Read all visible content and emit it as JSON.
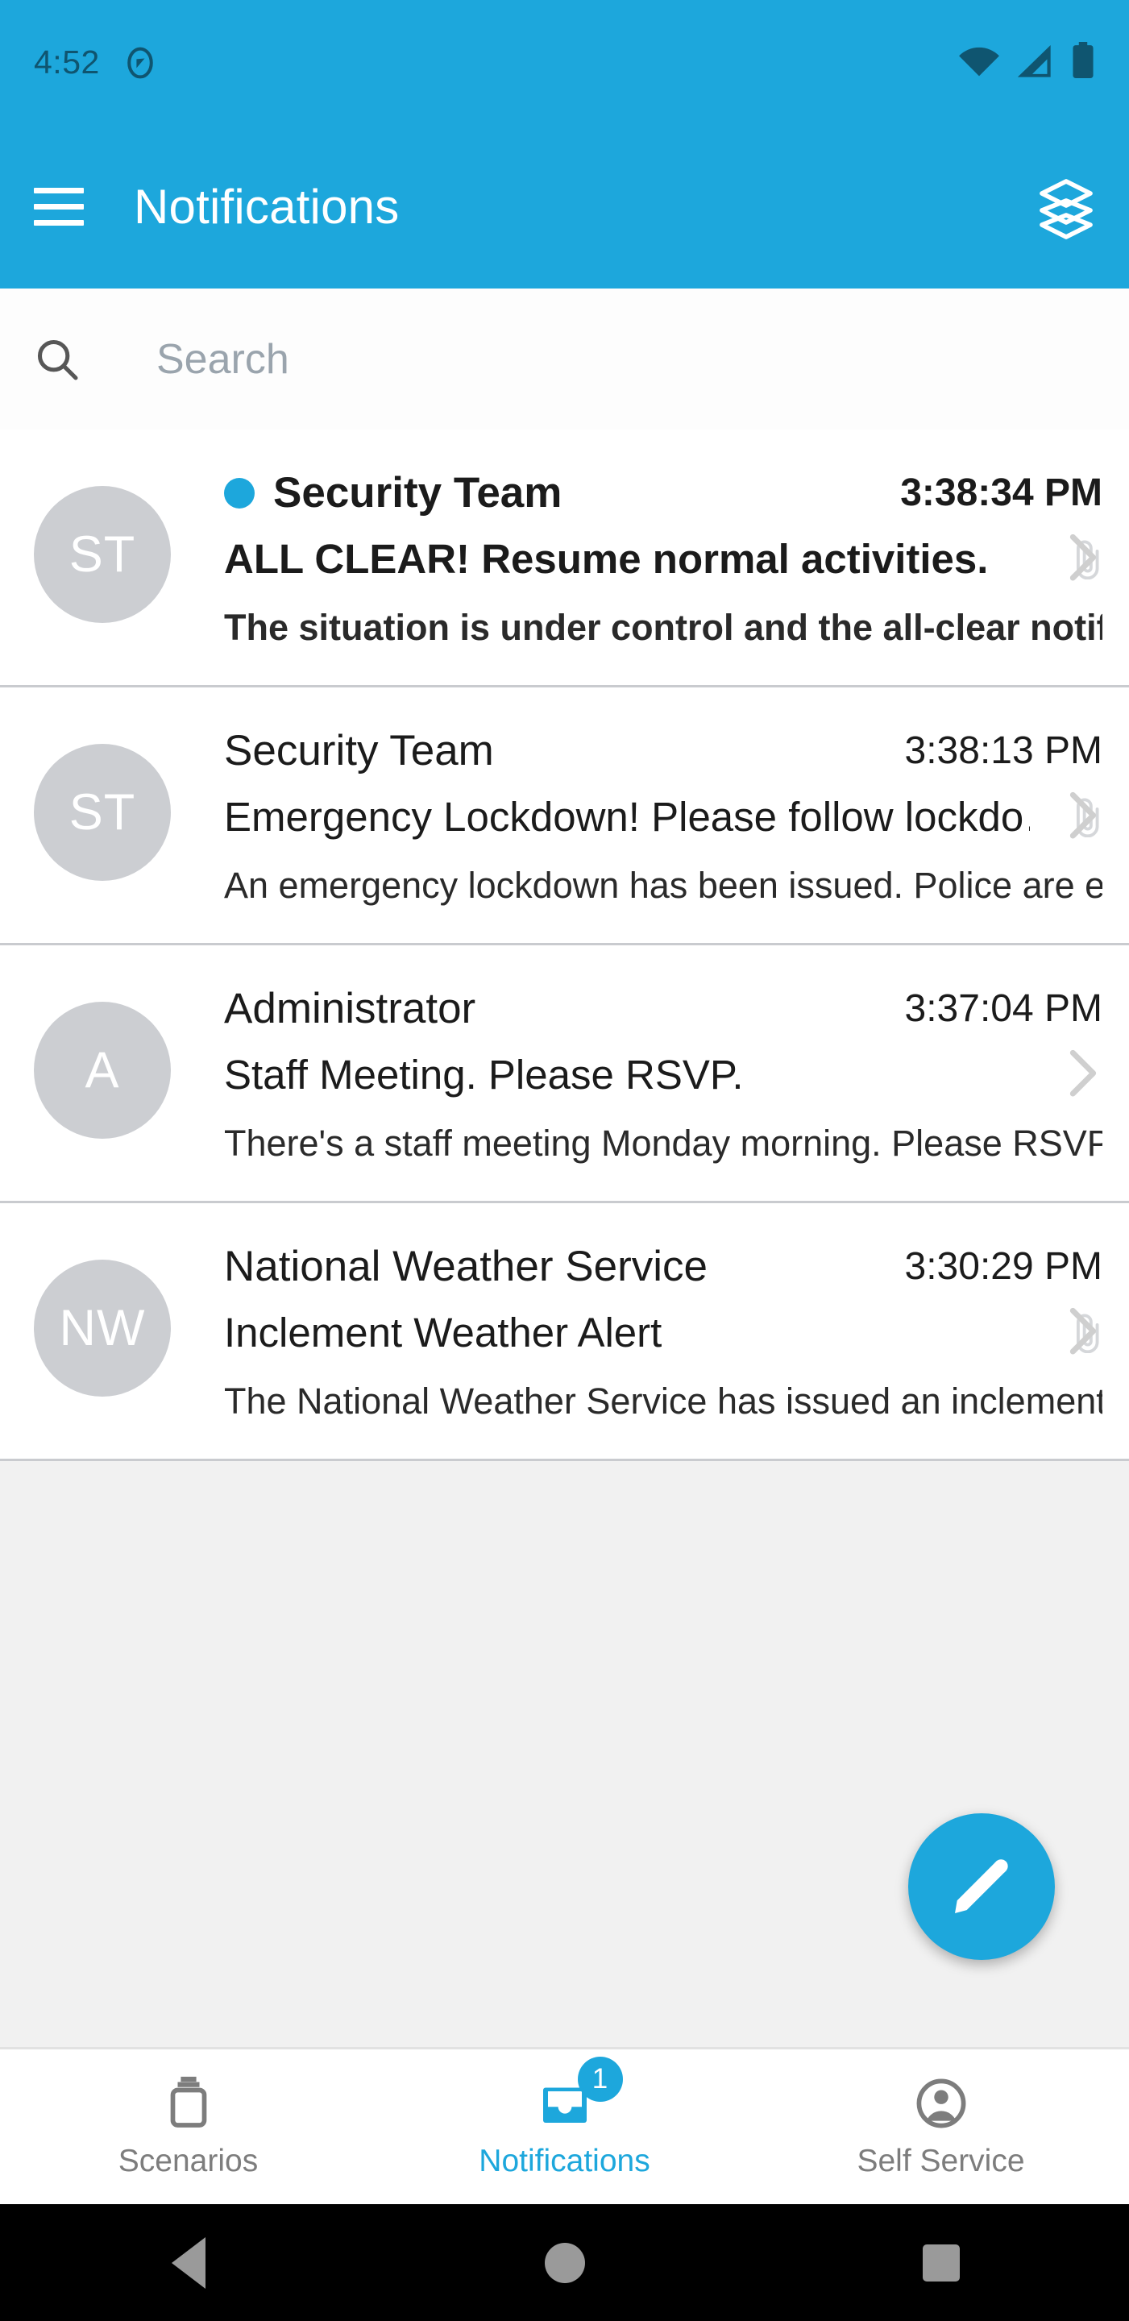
{
  "statusbar": {
    "time": "4:52",
    "icons": [
      "do-not-disturb-icon",
      "wifi-icon",
      "cellular-signal-icon",
      "battery-icon"
    ]
  },
  "appbar": {
    "menu_icon": "hamburger-menu-icon",
    "title": "Notifications",
    "action_icon": "layers-stack-icon"
  },
  "search": {
    "icon": "search-icon",
    "placeholder": "Search",
    "value": ""
  },
  "notifications": [
    {
      "avatar_initials": "ST",
      "sender": "Security Team",
      "time": "3:38:34 PM",
      "subject": "ALL CLEAR! Resume normal activities.",
      "preview": "The situation is under control and the all-clear notificat…",
      "unread": true,
      "has_attachment": true
    },
    {
      "avatar_initials": "ST",
      "sender": "Security Team",
      "time": "3:38:13 PM",
      "subject": "Emergency Lockdown! Please follow lockdo…",
      "preview": "An emergency lockdown has been issued. Police are en-…",
      "unread": false,
      "has_attachment": true
    },
    {
      "avatar_initials": "A",
      "sender": "Administrator",
      "time": "3:37:04 PM",
      "subject": "Staff Meeting. Please RSVP.",
      "preview": "There's a staff meeting Monday morning. Please RSVP a…",
      "unread": false,
      "has_attachment": false
    },
    {
      "avatar_initials": "NW",
      "sender": "National Weather Service",
      "time": "3:30:29 PM",
      "subject": "Inclement Weather Alert",
      "preview": "The National Weather Service has issued an inclement w…",
      "unread": false,
      "has_attachment": true
    }
  ],
  "fab": {
    "icon": "compose-pencil-icon",
    "label": "Compose"
  },
  "bottomnav": {
    "items": [
      {
        "label": "Scenarios",
        "icon": "scenarios-icon",
        "active": false,
        "badge": ""
      },
      {
        "label": "Notifications",
        "icon": "inbox-icon",
        "active": true,
        "badge": "1"
      },
      {
        "label": "Self Service",
        "icon": "account-circle-icon",
        "active": false,
        "badge": ""
      }
    ]
  },
  "androidnav": {
    "back": "back-triangle-icon",
    "home": "home-circle-icon",
    "recents": "recents-square-icon"
  },
  "colors": {
    "accent": "#1DA7DC",
    "appbar": "#1DA7DC",
    "empty_bg": "#F1F1F1",
    "avatar_bg": "#CCCED2",
    "divider": "#C9CBCF"
  }
}
